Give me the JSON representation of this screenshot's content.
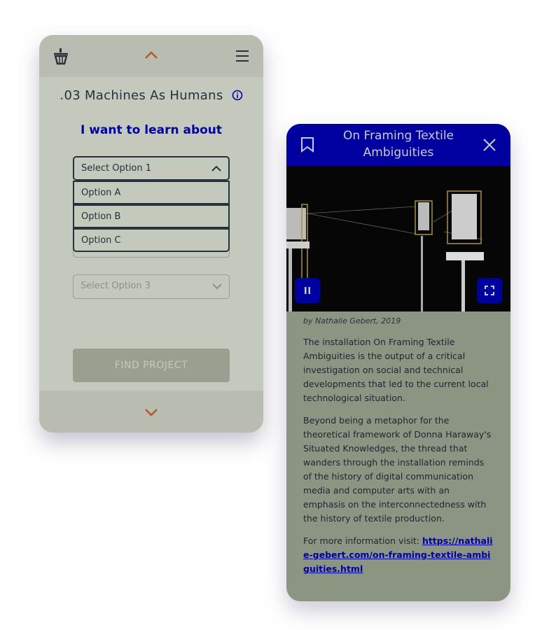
{
  "left_panel": {
    "title": ".03 Machines As Humans",
    "subtitle": "I want to learn about",
    "select1": {
      "value": "Select Option 1",
      "options": [
        "Option A",
        "Option B",
        "Option C"
      ]
    },
    "select3": {
      "value": "Select Option 3"
    },
    "find_button": "FIND PROJECT",
    "accent": "#b5592a"
  },
  "right_panel": {
    "title": "On Framing Textile Ambiguities",
    "byline": "by Nathalie Gebert, 2019",
    "paragraphs": [
      "The installation On Framing Textile Ambiguities is the output of a critical investigation on social and technical developments that led to the current local technological situation.",
      "Beyond being a metaphor for the theoretical framework of Donna Haraway's Situated Knowledges, the thread that wanders through the installation reminds of the history of digital communication media and computer arts with an emphasis on the interconnectedness with the history of textile production."
    ],
    "more_info_label": "For more information visit:",
    "link": "https://nathalie-gebert.com/on-framing-textile-ambiguities.html",
    "header_color": "#0000a0"
  }
}
